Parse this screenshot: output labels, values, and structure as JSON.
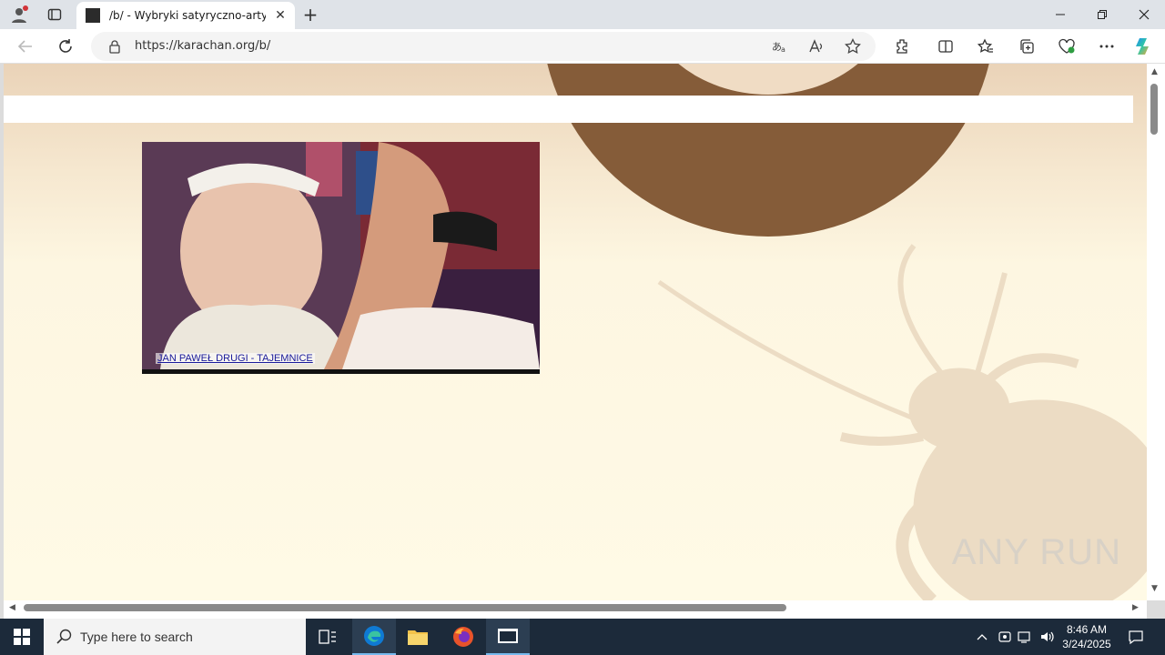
{
  "browser": {
    "tab_title": "/b/ - Wybryki satyryczno-artystyczne",
    "url": "https://karachan.org/b/",
    "new_tab_symbol": "+",
    "close_symbol": "✕"
  },
  "page": {
    "banner_caption": "JAN PAWEŁ DRUGI - TAJEMNICE",
    "watermark": "ANY RUN"
  },
  "colors": {
    "accent_brown": "#855c39",
    "page_bg": "#fffae6"
  },
  "taskbar": {
    "search_placeholder": "Type here to search",
    "time": "8:46 AM",
    "date": "3/24/2025"
  }
}
